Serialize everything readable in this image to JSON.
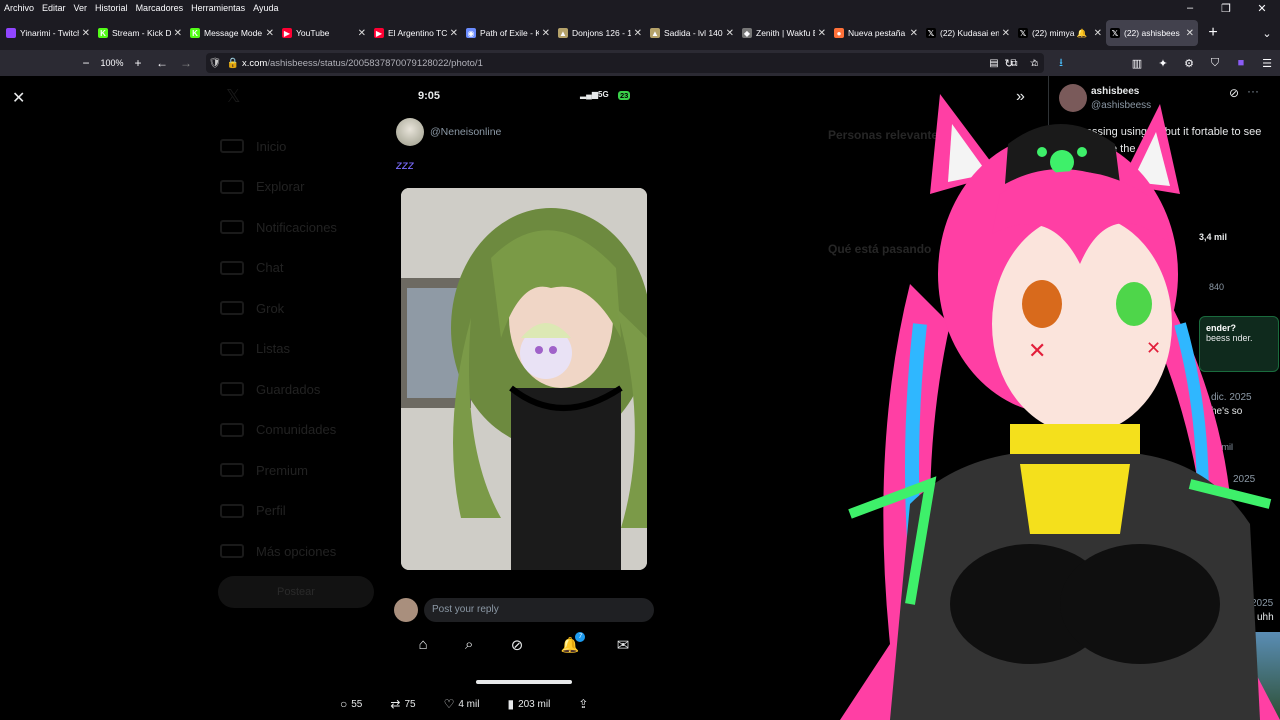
{
  "menubar": {
    "items": [
      "Archivo",
      "Editar",
      "Ver",
      "Historial",
      "Marcadores",
      "Herramientas",
      "Ayuda"
    ],
    "minimize": "–",
    "restore": "❐",
    "close": "✕"
  },
  "tabs": [
    {
      "label": "Yinarimi - Twitch",
      "icon": "twitch-icon",
      "color": "#9146ff",
      "glyph": ""
    },
    {
      "label": "Stream - Kick D",
      "icon": "kick-icon",
      "color": "#53fc18",
      "glyph": "K"
    },
    {
      "label": "Message Mode",
      "icon": "kick-icon",
      "color": "#53fc18",
      "glyph": "K"
    },
    {
      "label": "YouTube",
      "icon": "youtube-icon",
      "color": "#ff0033",
      "glyph": "▶"
    },
    {
      "label": "El Argentino TC",
      "icon": "youtube-icon",
      "color": "#ff0033",
      "glyph": "▶"
    },
    {
      "label": "Path of Exile - K",
      "icon": "poe-icon",
      "color": "#6b8cff",
      "glyph": "◉"
    },
    {
      "label": "Donjons 126 - 1",
      "icon": "dofus-icon",
      "color": "#b5a26a",
      "glyph": "▲"
    },
    {
      "label": "Sadida - lvl 140",
      "icon": "dofus-icon",
      "color": "#b5a26a",
      "glyph": "▲"
    },
    {
      "label": "Zenith | Wakfu E",
      "icon": "zenith-icon",
      "color": "#777777",
      "glyph": "◆"
    },
    {
      "label": "Nueva pestaña",
      "icon": "firefox-icon",
      "color": "#ff7139",
      "glyph": "●"
    },
    {
      "label": "(22) Kudasai en",
      "icon": "x-icon",
      "color": "#000000",
      "glyph": "𝕏"
    },
    {
      "label": "(22) mimya 🔔",
      "icon": "x-icon",
      "color": "#000000",
      "glyph": "𝕏"
    },
    {
      "label": "(22) ashisbees",
      "icon": "x-icon",
      "color": "#000000",
      "glyph": "𝕏",
      "active": true
    }
  ],
  "tabbar": {
    "new_tab": "+",
    "tab_list": "⌄"
  },
  "navbar": {
    "zoom_out": "−",
    "zoom": "100%",
    "zoom_in": "+",
    "back": "←",
    "forward": "→",
    "host": "x.com",
    "path": "/ashisbeess/status/2005837870079128022/photo/1"
  },
  "page": {
    "close": "✕",
    "expand": "»",
    "bg_nav": [
      "Inicio",
      "Explorar",
      "Notificaciones",
      "Chat",
      "Grok",
      "Listas",
      "Guardados",
      "Comunidades",
      "Premium",
      "Perfil",
      "Más opciones"
    ],
    "bg_post": "Postear",
    "bg_right_heading": "Personas relevantes",
    "bg_right_heading2": "Qué está pasando"
  },
  "phone": {
    "time": "9:05",
    "network": "5G",
    "battery": "23",
    "handle": "@Neneisonline",
    "zzz": "zzz",
    "reply_placeholder": "Post your reply",
    "notif_count": "7"
  },
  "actions": {
    "replies": "55",
    "reposts": "75",
    "likes": "4 mil",
    "views": "203 mil"
  },
  "rpanel": {
    "name": "ashisbees",
    "handle": "@ashisbeess",
    "text": "im guessing using ai, but it fortable to see like this. the the right",
    "views": "3,4 mil",
    "row2": "840",
    "card_title": "ender?",
    "card_sub": "beess nder.",
    "date1": "dic. 2025",
    "hesso": "he's so",
    "stat": "17 mil",
    "date2": "2025",
    "date3": "2025",
    "uhh": "uhh"
  }
}
